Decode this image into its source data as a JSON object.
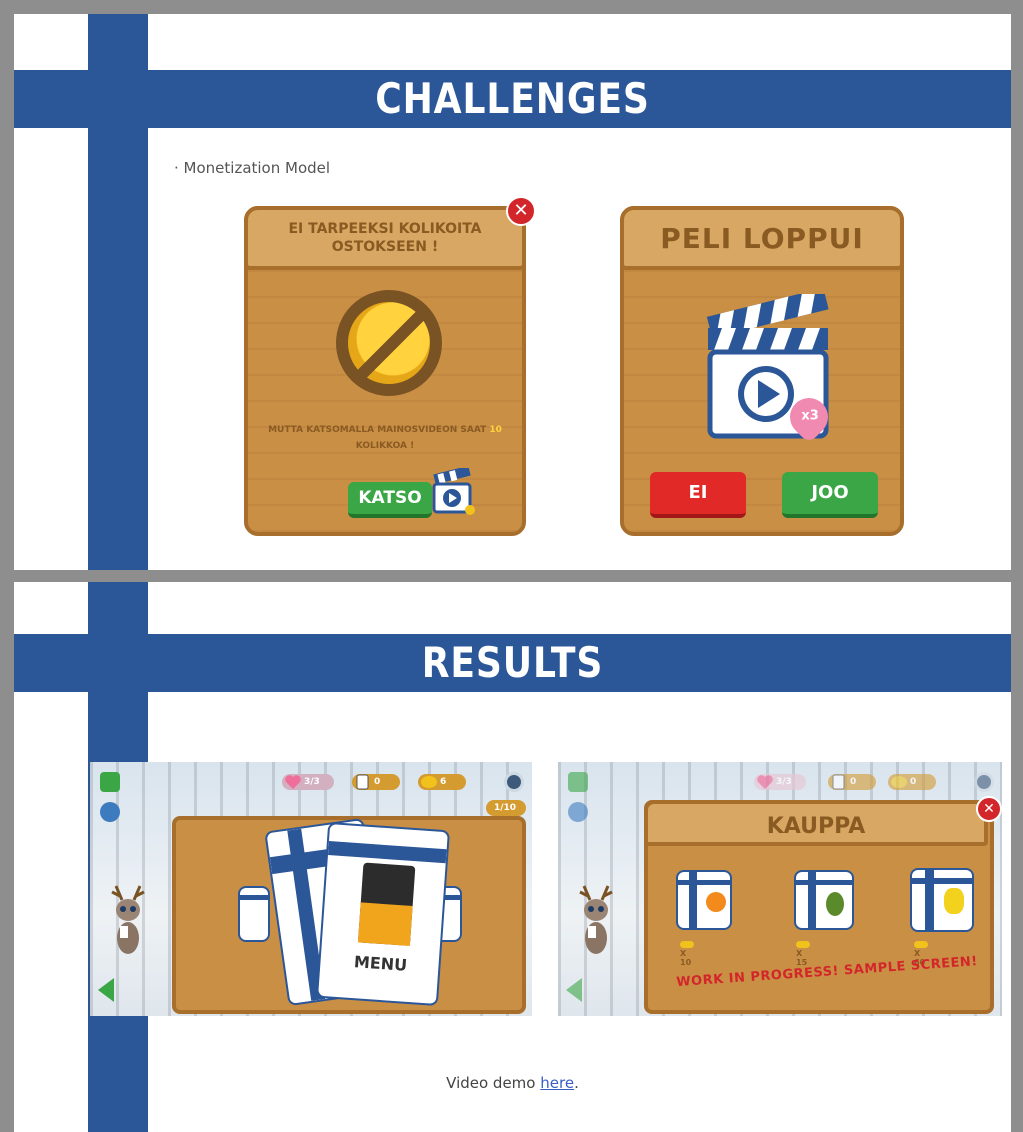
{
  "challenges": {
    "title": "CHALLENGES",
    "bullet": "· Monetization Model",
    "coins_dialog": {
      "header": "EI TARPEEKSI KOLIKOITA OSTOKSEEN !",
      "message_part1": "MUTTA KATSOMALLA MAINOSVIDEON SAAT ",
      "message_highlight": "10",
      "message_part2": " KOLIKKOA !",
      "watch_button": "KATSO",
      "close_glyph": "✕"
    },
    "gameover_dialog": {
      "header": "PELI LOPPUI",
      "badge": "x3",
      "no_button": "EI",
      "yes_button": "JOO"
    }
  },
  "results": {
    "title": "RESULTS",
    "shot1": {
      "hearts": "3/3",
      "cards": "0",
      "coins": "6",
      "progress": "1/10",
      "card_label": "MENU"
    },
    "shot2": {
      "hearts": "3/3",
      "cards": "0",
      "coins": "0",
      "shop_title": "KAUPPA",
      "prices": [
        "X 10",
        "X 15",
        "X 60"
      ],
      "wip_text": "WORK IN PROGRESS! SAMPLE SCREEN!",
      "close_glyph": "✕"
    },
    "footer_text": "Video demo ",
    "footer_link": "here",
    "footer_end": "."
  },
  "colors": {
    "flag_blue": "#2b5698",
    "frame_gray": "#8e8e8e",
    "wood": "#c98f45",
    "green_button": "#3aa646",
    "red_button": "#e12a27"
  }
}
